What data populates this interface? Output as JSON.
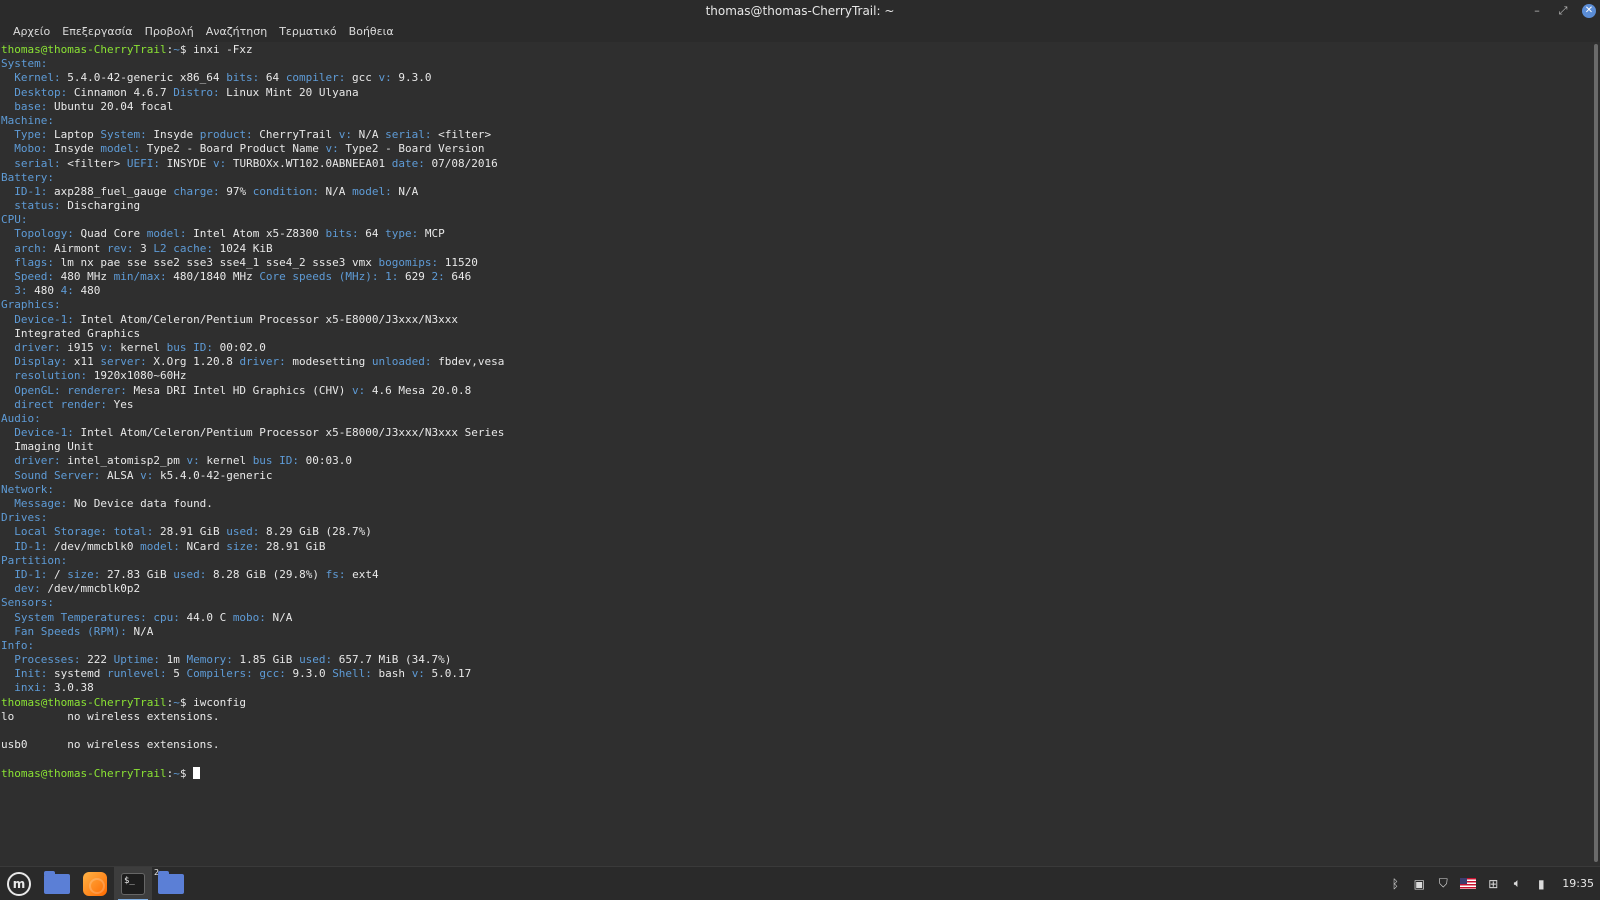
{
  "window": {
    "title": "thomas@thomas-CherryTrail: ~",
    "menu": [
      "Αρχείο",
      "Επεξεργασία",
      "Προβολή",
      "Αναζήτηση",
      "Τερματικό",
      "Βοήθεια"
    ]
  },
  "terminal": {
    "prompt_user": "thomas@thomas-CherryTrail",
    "lines": [
      [
        {
          "t": "thomas@thomas-CherryTrail",
          "c": "pu"
        },
        {
          "t": ":"
        },
        {
          "t": "~",
          "c": "pp"
        },
        {
          "t": "$ inxi -Fxz"
        }
      ],
      [
        {
          "t": "System:",
          "c": "h"
        }
      ],
      [
        {
          "t": "  "
        },
        {
          "t": "Kernel:",
          "c": "k"
        },
        {
          "t": " 5.4.0-42-generic x86_64 "
        },
        {
          "t": "bits:",
          "c": "k"
        },
        {
          "t": " 64 "
        },
        {
          "t": "compiler:",
          "c": "k"
        },
        {
          "t": " gcc "
        },
        {
          "t": "v:",
          "c": "k"
        },
        {
          "t": " 9.3.0"
        }
      ],
      [
        {
          "t": "  "
        },
        {
          "t": "Desktop:",
          "c": "k"
        },
        {
          "t": " Cinnamon 4.6.7 "
        },
        {
          "t": "Distro:",
          "c": "k"
        },
        {
          "t": " Linux Mint 20 Ulyana"
        }
      ],
      [
        {
          "t": "  "
        },
        {
          "t": "base:",
          "c": "k"
        },
        {
          "t": " Ubuntu 20.04 focal"
        }
      ],
      [
        {
          "t": "Machine:",
          "c": "h"
        }
      ],
      [
        {
          "t": "  "
        },
        {
          "t": "Type:",
          "c": "k"
        },
        {
          "t": " Laptop "
        },
        {
          "t": "System:",
          "c": "k"
        },
        {
          "t": " Insyde "
        },
        {
          "t": "product:",
          "c": "k"
        },
        {
          "t": " CherryTrail "
        },
        {
          "t": "v:",
          "c": "k"
        },
        {
          "t": " N/A "
        },
        {
          "t": "serial:",
          "c": "k"
        },
        {
          "t": " <filter>"
        }
      ],
      [
        {
          "t": "  "
        },
        {
          "t": "Mobo:",
          "c": "k"
        },
        {
          "t": " Insyde "
        },
        {
          "t": "model:",
          "c": "k"
        },
        {
          "t": " Type2 - Board Product Name "
        },
        {
          "t": "v:",
          "c": "k"
        },
        {
          "t": " Type2 - Board Version"
        }
      ],
      [
        {
          "t": "  "
        },
        {
          "t": "serial:",
          "c": "k"
        },
        {
          "t": " <filter> "
        },
        {
          "t": "UEFI:",
          "c": "k"
        },
        {
          "t": " INSYDE "
        },
        {
          "t": "v:",
          "c": "k"
        },
        {
          "t": " TURBOXx.WT102.0ABNEEA01 "
        },
        {
          "t": "date:",
          "c": "k"
        },
        {
          "t": " 07/08/2016"
        }
      ],
      [
        {
          "t": "Battery:",
          "c": "h"
        }
      ],
      [
        {
          "t": "  "
        },
        {
          "t": "ID-1:",
          "c": "k"
        },
        {
          "t": " axp288_fuel_gauge "
        },
        {
          "t": "charge:",
          "c": "k"
        },
        {
          "t": " 97% "
        },
        {
          "t": "condition:",
          "c": "k"
        },
        {
          "t": " N/A "
        },
        {
          "t": "model:",
          "c": "k"
        },
        {
          "t": " N/A"
        }
      ],
      [
        {
          "t": "  "
        },
        {
          "t": "status:",
          "c": "k"
        },
        {
          "t": " Discharging"
        }
      ],
      [
        {
          "t": "CPU:",
          "c": "h"
        }
      ],
      [
        {
          "t": "  "
        },
        {
          "t": "Topology:",
          "c": "k"
        },
        {
          "t": " Quad Core "
        },
        {
          "t": "model:",
          "c": "k"
        },
        {
          "t": " Intel Atom x5-Z8300 "
        },
        {
          "t": "bits:",
          "c": "k"
        },
        {
          "t": " 64 "
        },
        {
          "t": "type:",
          "c": "k"
        },
        {
          "t": " MCP"
        }
      ],
      [
        {
          "t": "  "
        },
        {
          "t": "arch:",
          "c": "k"
        },
        {
          "t": " Airmont "
        },
        {
          "t": "rev:",
          "c": "k"
        },
        {
          "t": " 3 "
        },
        {
          "t": "L2 cache:",
          "c": "k"
        },
        {
          "t": " 1024 KiB"
        }
      ],
      [
        {
          "t": "  "
        },
        {
          "t": "flags:",
          "c": "k"
        },
        {
          "t": " lm nx pae sse sse2 sse3 sse4_1 sse4_2 ssse3 vmx "
        },
        {
          "t": "bogomips:",
          "c": "k"
        },
        {
          "t": " 11520"
        }
      ],
      [
        {
          "t": "  "
        },
        {
          "t": "Speed:",
          "c": "k"
        },
        {
          "t": " 480 MHz "
        },
        {
          "t": "min/max:",
          "c": "k"
        },
        {
          "t": " 480/1840 MHz "
        },
        {
          "t": "Core speeds (MHz):",
          "c": "k"
        },
        {
          "t": " "
        },
        {
          "t": "1:",
          "c": "k"
        },
        {
          "t": " 629 "
        },
        {
          "t": "2:",
          "c": "k"
        },
        {
          "t": " 646"
        }
      ],
      [
        {
          "t": "  "
        },
        {
          "t": "3:",
          "c": "k"
        },
        {
          "t": " 480 "
        },
        {
          "t": "4:",
          "c": "k"
        },
        {
          "t": " 480"
        }
      ],
      [
        {
          "t": "Graphics:",
          "c": "h"
        }
      ],
      [
        {
          "t": "  "
        },
        {
          "t": "Device-1:",
          "c": "k"
        },
        {
          "t": " Intel Atom/Celeron/Pentium Processor x5-E8000/J3xxx/N3xxx"
        }
      ],
      [
        {
          "t": "  Integrated Graphics"
        }
      ],
      [
        {
          "t": "  "
        },
        {
          "t": "driver:",
          "c": "k"
        },
        {
          "t": " i915 "
        },
        {
          "t": "v:",
          "c": "k"
        },
        {
          "t": " kernel "
        },
        {
          "t": "bus ID:",
          "c": "k"
        },
        {
          "t": " 00:02.0"
        }
      ],
      [
        {
          "t": "  "
        },
        {
          "t": "Display:",
          "c": "k"
        },
        {
          "t": " x11 "
        },
        {
          "t": "server:",
          "c": "k"
        },
        {
          "t": " X.Org 1.20.8 "
        },
        {
          "t": "driver:",
          "c": "k"
        },
        {
          "t": " modesetting "
        },
        {
          "t": "unloaded:",
          "c": "k"
        },
        {
          "t": " fbdev,vesa"
        }
      ],
      [
        {
          "t": "  "
        },
        {
          "t": "resolution:",
          "c": "k"
        },
        {
          "t": " 1920x1080~60Hz"
        }
      ],
      [
        {
          "t": "  "
        },
        {
          "t": "OpenGL:",
          "c": "k"
        },
        {
          "t": " "
        },
        {
          "t": "renderer:",
          "c": "k"
        },
        {
          "t": " Mesa DRI Intel HD Graphics (CHV) "
        },
        {
          "t": "v:",
          "c": "k"
        },
        {
          "t": " 4.6 Mesa 20.0.8"
        }
      ],
      [
        {
          "t": "  "
        },
        {
          "t": "direct render:",
          "c": "k"
        },
        {
          "t": " Yes"
        }
      ],
      [
        {
          "t": "Audio:",
          "c": "h"
        }
      ],
      [
        {
          "t": "  "
        },
        {
          "t": "Device-1:",
          "c": "k"
        },
        {
          "t": " Intel Atom/Celeron/Pentium Processor x5-E8000/J3xxx/N3xxx Series"
        }
      ],
      [
        {
          "t": "  Imaging Unit"
        }
      ],
      [
        {
          "t": "  "
        },
        {
          "t": "driver:",
          "c": "k"
        },
        {
          "t": " intel_atomisp2_pm "
        },
        {
          "t": "v:",
          "c": "k"
        },
        {
          "t": " kernel "
        },
        {
          "t": "bus ID:",
          "c": "k"
        },
        {
          "t": " 00:03.0"
        }
      ],
      [
        {
          "t": "  "
        },
        {
          "t": "Sound Server:",
          "c": "k"
        },
        {
          "t": " ALSA "
        },
        {
          "t": "v:",
          "c": "k"
        },
        {
          "t": " k5.4.0-42-generic"
        }
      ],
      [
        {
          "t": "Network:",
          "c": "h"
        }
      ],
      [
        {
          "t": "  "
        },
        {
          "t": "Message:",
          "c": "k"
        },
        {
          "t": " No Device data found."
        }
      ],
      [
        {
          "t": "Drives:",
          "c": "h"
        }
      ],
      [
        {
          "t": "  "
        },
        {
          "t": "Local Storage:",
          "c": "k"
        },
        {
          "t": " "
        },
        {
          "t": "total:",
          "c": "k"
        },
        {
          "t": " 28.91 GiB "
        },
        {
          "t": "used:",
          "c": "k"
        },
        {
          "t": " 8.29 GiB (28.7%)"
        }
      ],
      [
        {
          "t": "  "
        },
        {
          "t": "ID-1:",
          "c": "k"
        },
        {
          "t": " /dev/mmcblk0 "
        },
        {
          "t": "model:",
          "c": "k"
        },
        {
          "t": " NCard "
        },
        {
          "t": "size:",
          "c": "k"
        },
        {
          "t": " 28.91 GiB"
        }
      ],
      [
        {
          "t": "Partition:",
          "c": "h"
        }
      ],
      [
        {
          "t": "  "
        },
        {
          "t": "ID-1:",
          "c": "k"
        },
        {
          "t": " / "
        },
        {
          "t": "size:",
          "c": "k"
        },
        {
          "t": " 27.83 GiB "
        },
        {
          "t": "used:",
          "c": "k"
        },
        {
          "t": " 8.28 GiB (29.8%) "
        },
        {
          "t": "fs:",
          "c": "k"
        },
        {
          "t": " ext4"
        }
      ],
      [
        {
          "t": "  "
        },
        {
          "t": "dev:",
          "c": "k"
        },
        {
          "t": " /dev/mmcblk0p2"
        }
      ],
      [
        {
          "t": "Sensors:",
          "c": "h"
        }
      ],
      [
        {
          "t": "  "
        },
        {
          "t": "System Temperatures:",
          "c": "k"
        },
        {
          "t": " "
        },
        {
          "t": "cpu:",
          "c": "k"
        },
        {
          "t": " 44.0 C "
        },
        {
          "t": "mobo:",
          "c": "k"
        },
        {
          "t": " N/A"
        }
      ],
      [
        {
          "t": "  "
        },
        {
          "t": "Fan Speeds (RPM):",
          "c": "k"
        },
        {
          "t": " N/A"
        }
      ],
      [
        {
          "t": "Info:",
          "c": "h"
        }
      ],
      [
        {
          "t": "  "
        },
        {
          "t": "Processes:",
          "c": "k"
        },
        {
          "t": " 222 "
        },
        {
          "t": "Uptime:",
          "c": "k"
        },
        {
          "t": " 1m "
        },
        {
          "t": "Memory:",
          "c": "k"
        },
        {
          "t": " 1.85 GiB "
        },
        {
          "t": "used:",
          "c": "k"
        },
        {
          "t": " 657.7 MiB (34.7%)"
        }
      ],
      [
        {
          "t": "  "
        },
        {
          "t": "Init:",
          "c": "k"
        },
        {
          "t": " systemd "
        },
        {
          "t": "runlevel:",
          "c": "k"
        },
        {
          "t": " 5 "
        },
        {
          "t": "Compilers:",
          "c": "k"
        },
        {
          "t": " "
        },
        {
          "t": "gcc:",
          "c": "k"
        },
        {
          "t": " 9.3.0 "
        },
        {
          "t": "Shell:",
          "c": "k"
        },
        {
          "t": " bash "
        },
        {
          "t": "v:",
          "c": "k"
        },
        {
          "t": " 5.0.17"
        }
      ],
      [
        {
          "t": "  "
        },
        {
          "t": "inxi:",
          "c": "k"
        },
        {
          "t": " 3.0.38"
        }
      ],
      [
        {
          "t": "thomas@thomas-CherryTrail",
          "c": "pu"
        },
        {
          "t": ":"
        },
        {
          "t": "~",
          "c": "pp"
        },
        {
          "t": "$ iwconfig"
        }
      ],
      [
        {
          "t": "lo        no wireless extensions."
        }
      ],
      [
        {
          "t": ""
        }
      ],
      [
        {
          "t": "usb0      no wireless extensions."
        }
      ],
      [
        {
          "t": ""
        }
      ],
      [
        {
          "t": "thomas@thomas-CherryTrail",
          "c": "pu"
        },
        {
          "t": ":"
        },
        {
          "t": "~",
          "c": "pp"
        },
        {
          "t": "$ "
        },
        {
          "cursor": true
        }
      ]
    ]
  },
  "taskbar": {
    "menu_icon": "mint-logo-icon",
    "apps": [
      {
        "name": "files",
        "icon": "folder-icon"
      },
      {
        "name": "firefox",
        "icon": "firefox-icon"
      },
      {
        "name": "terminal",
        "icon": "terminal-icon",
        "active": true,
        "label": "$_"
      },
      {
        "name": "files-group",
        "icon": "folder-icon",
        "badge": "2"
      }
    ],
    "tray": {
      "icons": [
        "bluetooth-icon",
        "clipboard-icon",
        "shield-icon",
        "us-flag-icon",
        "network-icon",
        "volume-icon",
        "battery-icon"
      ],
      "clock": "19:35"
    }
  },
  "colors": {
    "key": "#5e9bd6",
    "prompt_user": "#8ae234",
    "text": "#e8e8e8",
    "background": "#2f2f2f"
  }
}
